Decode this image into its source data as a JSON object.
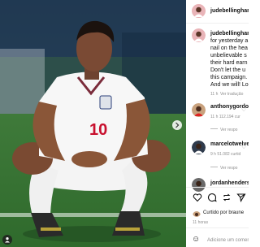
{
  "post": {
    "author": "judebellingham",
    "caption_user": "judebellingham",
    "caption_lines": [
      "for yesterday a",
      "nail on the hea",
      "unbelievable s",
      "their hard earn",
      "Don't let the u",
      "this campaign.",
      "And we will! Lo"
    ],
    "caption_time": "11 h",
    "caption_translate": "Ver tradução",
    "likes_line": "Curtido por braune",
    "likes_name": "braune",
    "post_time": "11 horas",
    "add_comment_placeholder": "Adicione um comentário..."
  },
  "comments": [
    {
      "user": "anthonygordo",
      "meta": "11 h   112.194 cur",
      "replies": "Ver respo"
    },
    {
      "user": "marcelotwelve",
      "meta": "9 h   51.082 curtid",
      "replies": "Ver respo"
    },
    {
      "user": "jordanhenders",
      "meta": "",
      "replies": ""
    }
  ],
  "photo": {
    "shirt_number": "10"
  },
  "icons": [
    "heart-icon",
    "comment-icon",
    "share-icon",
    "save-icon",
    "emoji-icon",
    "chevron-right-icon",
    "person-tag-icon"
  ]
}
